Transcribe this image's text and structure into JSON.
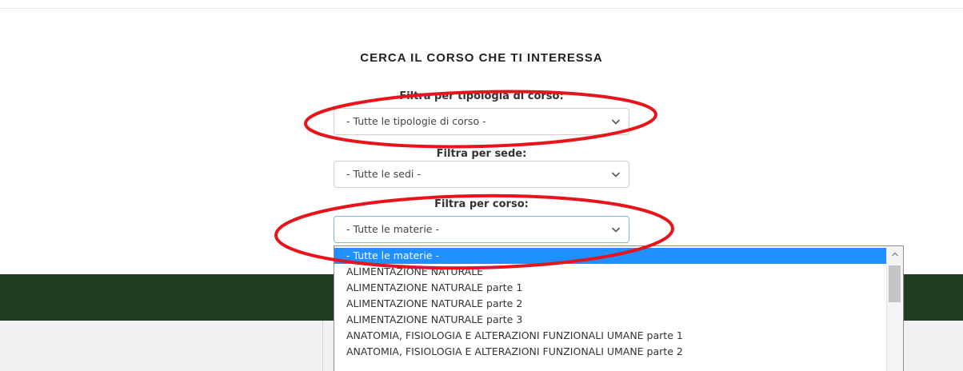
{
  "page": {
    "title": "CERCA IL CORSO CHE TI INTERESSA"
  },
  "filters": {
    "tipologia": {
      "label": "Filtra per tipologia di corso:",
      "value": "- Tutte le tipologie di corso -"
    },
    "sede": {
      "label": "Filtra per sede:",
      "value": "- Tutte le sedi -"
    },
    "corso": {
      "label": "Filtra per corso:",
      "value": "- Tutte le materie -"
    }
  },
  "dropdown": {
    "options": [
      "- Tutte le materie -",
      "ALIMENTAZIONE NATURALE",
      "ALIMENTAZIONE NATURALE parte 1",
      "ALIMENTAZIONE NATURALE parte 2",
      "ALIMENTAZIONE NATURALE parte 3",
      "ANATOMIA, FISIOLOGIA E ALTERAZIONI FUNZIONALI UMANE parte 1",
      "ANATOMIA, FISIOLOGIA E ALTERAZIONI FUNZIONALI UMANE parte 2"
    ],
    "selected_index": 0
  },
  "colors": {
    "highlight": "#1e90ff",
    "annotation_red": "#e8141b",
    "band_green": "#203d21"
  },
  "icons": {
    "select_arrow": "chevron-down-icon",
    "scroll_arrow": "chevron-up-icon"
  }
}
